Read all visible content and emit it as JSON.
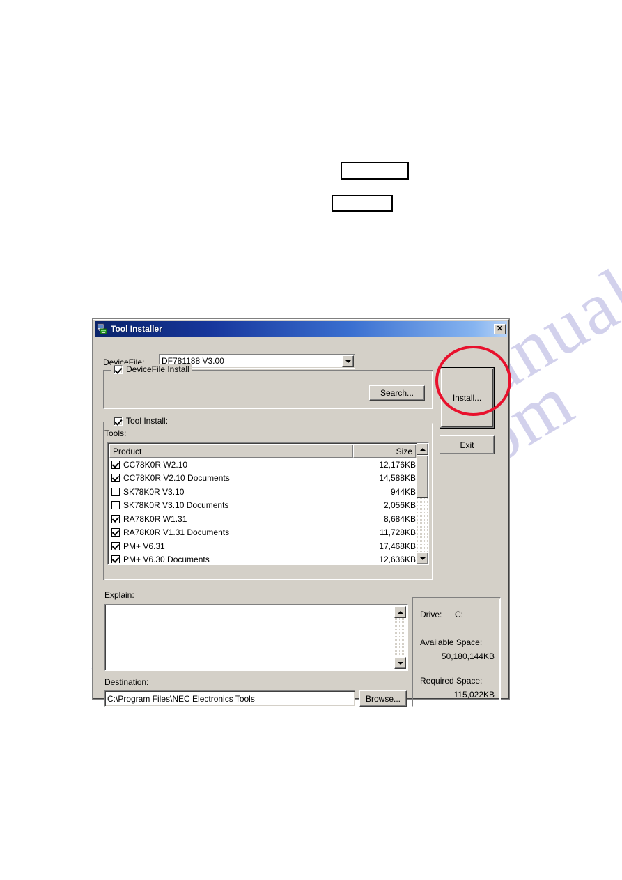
{
  "page": {
    "watermark_text": "manualshive.com"
  },
  "callouts": [
    {
      "name": "callout-box-1",
      "text": ""
    },
    {
      "name": "callout-box-2",
      "text": ""
    }
  ],
  "window": {
    "title": "Tool Installer",
    "icon": "installer-icon",
    "close_label": "✕"
  },
  "device_file_group": {
    "legend_label": "DeviceFile Install",
    "legend_checked": true,
    "field_label": "DeviceFile:",
    "selected_value": "DF781188 V3.00",
    "dropdown_icon": "chevron-down-icon",
    "search_button_label": "Search..."
  },
  "tool_install_group": {
    "legend_label": "Tool Install:",
    "legend_checked": true,
    "tools_label": "Tools:",
    "columns": {
      "product": "Product",
      "size": "Size"
    },
    "rows": [
      {
        "checked": true,
        "product": "CC78K0R W2.10",
        "size": "12,176KB"
      },
      {
        "checked": true,
        "product": "CC78K0R V2.10 Documents",
        "size": "14,588KB"
      },
      {
        "checked": false,
        "product": "SK78K0R V3.10",
        "size": "944KB"
      },
      {
        "checked": false,
        "product": "SK78K0R V3.10 Documents",
        "size": "2,056KB"
      },
      {
        "checked": true,
        "product": "RA78K0R W1.31",
        "size": "8,684KB"
      },
      {
        "checked": true,
        "product": "RA78K0R V1.31 Documents",
        "size": "11,728KB"
      },
      {
        "checked": true,
        "product": "PM+ V6.31",
        "size": "17,468KB"
      },
      {
        "checked": true,
        "product": "PM+ V6.30 Documents",
        "size": "12,636KB"
      }
    ],
    "scroll_up_icon": "triangle-up-icon",
    "scroll_down_icon": "triangle-down-icon"
  },
  "explain": {
    "label": "Explain:",
    "content": "",
    "scroll_up_icon": "triangle-up-icon",
    "scroll_down_icon": "triangle-down-icon"
  },
  "destination": {
    "label": "Destination:",
    "value": "C:\\Program Files\\NEC Electronics Tools",
    "browse_button_label": "Browse..."
  },
  "drive_info": {
    "drive_label": "Drive:",
    "drive_value": "C:",
    "available_space_label": "Available Space:",
    "available_space_value": "50,180,144KB",
    "required_space_label": "Required Space:",
    "required_space_value": "115,022KB"
  },
  "actions": {
    "install_label": "Install...",
    "exit_label": "Exit"
  },
  "annotation": {
    "name": "install-highlight-ellipse",
    "color": "#e8112d",
    "targets": "install-button"
  }
}
